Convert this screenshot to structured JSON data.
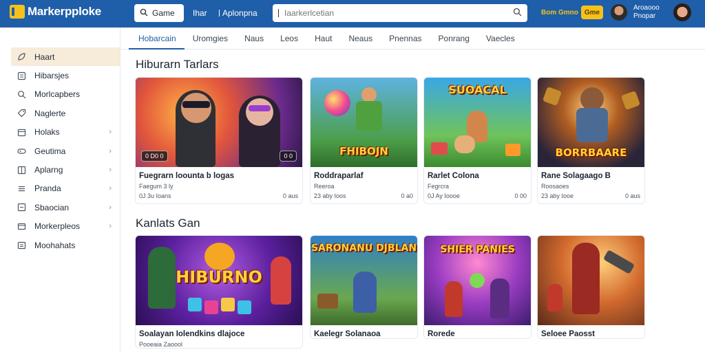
{
  "app": {
    "logo_text": "Markerpploke",
    "small_search": "Game",
    "nav_item_1": "Ihar",
    "nav_item_2": "Aplonpna",
    "search_placeholder": "Iaarkerlcetian",
    "points_text": "Bom Gmno",
    "badge_label": "Gme",
    "user_name_line1": "Aroaooo",
    "user_name_line2": "Pnopar"
  },
  "tabs": [
    {
      "label": "Hobarcain",
      "active": true
    },
    {
      "label": "Uromgies"
    },
    {
      "label": "Naus"
    },
    {
      "label": "Leos"
    },
    {
      "label": "Haut"
    },
    {
      "label": "Neaus"
    },
    {
      "label": "Pnennas"
    },
    {
      "label": "Ponrang"
    },
    {
      "label": "Vaecles"
    }
  ],
  "sidebar": {
    "items": [
      {
        "label": "Haart",
        "icon": "leaf-icon",
        "active": true,
        "chevron": false
      },
      {
        "label": "Hibarsjes",
        "icon": "list-icon",
        "chevron": false
      },
      {
        "label": "Morlcapbers",
        "icon": "search-icon",
        "chevron": false
      },
      {
        "label": "Naglerte",
        "icon": "tag-icon",
        "chevron": false
      },
      {
        "label": "Holaks",
        "icon": "calendar-icon",
        "chevron": true
      },
      {
        "label": "Geutima",
        "icon": "gamepad-icon",
        "chevron": true
      },
      {
        "label": "Aplarng",
        "icon": "grid-icon",
        "chevron": true
      },
      {
        "label": "Pranda",
        "icon": "menu-icon",
        "chevron": true
      },
      {
        "label": "Sbaocian",
        "icon": "box-icon",
        "chevron": true
      },
      {
        "label": "Morkerpleos",
        "icon": "cart-icon",
        "chevron": true
      },
      {
        "label": "Moohahats",
        "icon": "folder-icon",
        "chevron": false
      }
    ]
  },
  "sections": [
    {
      "title": "Hiburarn Tarlars",
      "cards": [
        {
          "title": "Fuegrarn loounta b logas",
          "sub": "Faegum 3 ly",
          "meta_left": "0J 3u Ioans",
          "meta_right": "0 aus",
          "tag_left": "0 D0 0",
          "tag_right": "0 0"
        },
        {
          "title": "Roddraparlaf",
          "sub": "Reeroa",
          "meta_left": "23 aby Ioos",
          "meta_right": "0 a0",
          "thumb_label": "FHIBOJN"
        },
        {
          "title": "Rarlet Colona",
          "sub": "Fegrcra",
          "meta_left": "0J Ay Ioooe",
          "meta_right": "0 00",
          "thumb_label": "SUOACAL"
        },
        {
          "title": "Rane Solagaago B",
          "sub": "Roosaoes",
          "meta_left": "23 aby Iooe",
          "meta_right": "0 aus",
          "thumb_label": "BORRBAARE"
        }
      ]
    },
    {
      "title": "Kanlats Gan",
      "cards": [
        {
          "title": "Soalayan Iolendkins dlajoce",
          "sub": "Pooeaia Zaoool",
          "thumb_label": "HIBURNO"
        },
        {
          "title": "Kaelegr Solanaoa",
          "sub": "",
          "thumb_label": "SARONANU DJBLAN"
        },
        {
          "title": "Rorede",
          "sub": "",
          "thumb_label": "SHIER PANIES"
        },
        {
          "title": "Seloee Paosst",
          "sub": "",
          "thumb_label": ""
        }
      ]
    }
  ]
}
